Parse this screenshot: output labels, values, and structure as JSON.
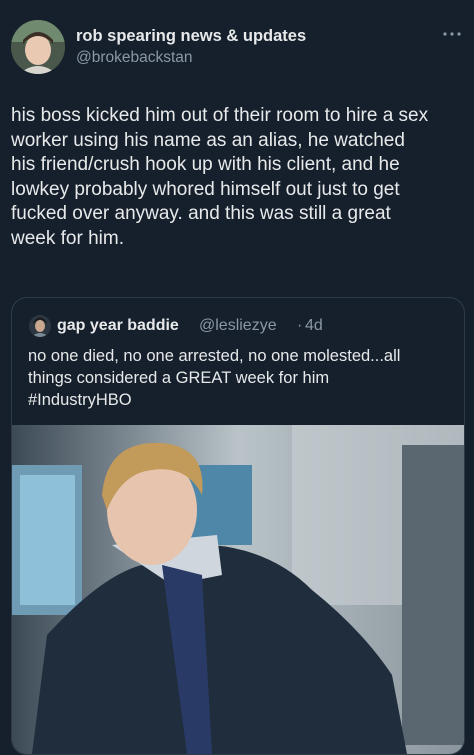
{
  "tweet": {
    "author": {
      "name": "rob spearing news & updates",
      "handle": "@brokebackstan"
    },
    "more_icon": "ellipsis-icon",
    "text_lines": [
      "his boss kicked him out of their room to hire a sex",
      "worker using his name as an alias, he watched",
      "his friend/crush hook up with his client, and he",
      "lowkey probably whored himself out just to get",
      "fucked over anyway. and this was still a great",
      "week for him."
    ]
  },
  "quote": {
    "author": {
      "name": "gap year baddie",
      "handle": "@lesliezye",
      "separator": "·",
      "time": "4d"
    },
    "text_lines": [
      "no one died, no one arrested, no one molested...all",
      "things considered a GREAT week for him",
      "#IndustryHBO"
    ]
  },
  "colors": {
    "background": "#16202c",
    "text": "#e7e9ea",
    "secondary": "#8b98a5",
    "border": "#2f3c4a"
  }
}
